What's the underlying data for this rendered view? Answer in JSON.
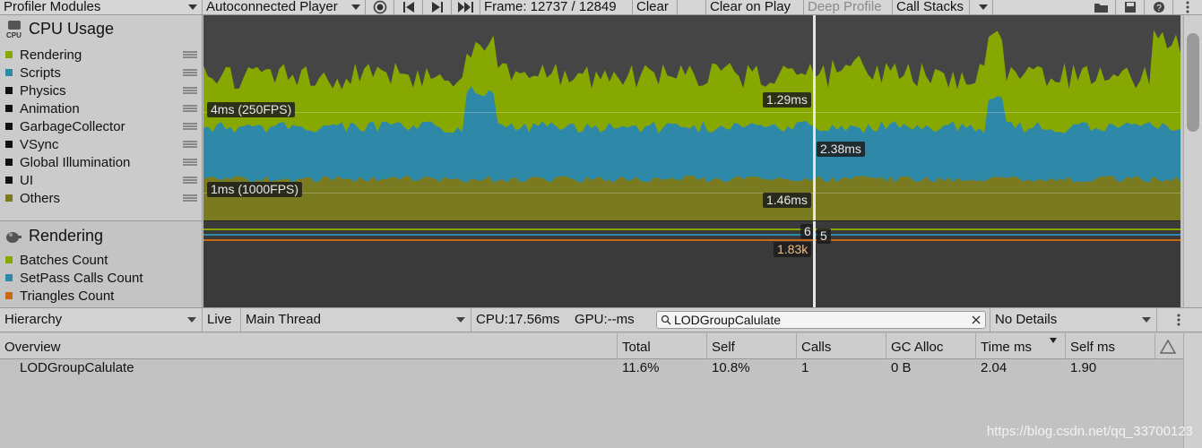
{
  "toolbar": {
    "modules_label": "Profiler Modules",
    "player_label": "Autoconnected Player",
    "frame_label": "Frame: 12737 / 12849",
    "clear_label": "Clear",
    "clear_on_play_label": "Clear on Play",
    "deep_profile_label": "Deep Profile",
    "call_stacks_label": "Call Stacks"
  },
  "cpu_module": {
    "title": "CPU Usage",
    "icon_text": "CPU",
    "legend": [
      {
        "label": "Rendering",
        "color": "#86a800"
      },
      {
        "label": "Scripts",
        "color": "#2e88a8"
      },
      {
        "label": "Physics",
        "color": "#111111"
      },
      {
        "label": "Animation",
        "color": "#111111"
      },
      {
        "label": "GarbageCollector",
        "color": "#111111"
      },
      {
        "label": "VSync",
        "color": "#111111"
      },
      {
        "label": "Global Illumination",
        "color": "#111111"
      },
      {
        "label": "UI",
        "color": "#111111"
      },
      {
        "label": "Others",
        "color": "#7a7a20"
      }
    ],
    "chart": {
      "line_4ms": "4ms (250FPS)",
      "line_1ms": "1ms (1000FPS)",
      "val_rendering": "1.29ms",
      "val_scripts": "2.38ms",
      "val_others": "1.46ms"
    }
  },
  "rendering_module": {
    "title": "Rendering",
    "legend": [
      {
        "label": "Batches Count",
        "color": "#86a800"
      },
      {
        "label": "SetPass Calls Count",
        "color": "#2e88a8"
      },
      {
        "label": "Triangles Count",
        "color": "#c86a14"
      }
    ],
    "chart": {
      "val_batches": "6",
      "val_setpass": "5",
      "val_triangles": "1.83k"
    }
  },
  "hierarchy_bar": {
    "view_label": "Hierarchy",
    "live_label": "Live",
    "thread_label": "Main Thread",
    "cpu_label": "CPU:17.56ms",
    "gpu_label": "GPU:--ms",
    "search_value": "LODGroupCalulate",
    "details_label": "No Details"
  },
  "table": {
    "columns": [
      "Overview",
      "Total",
      "Self",
      "Calls",
      "GC Alloc",
      "Time ms",
      "Self ms"
    ],
    "rows": [
      {
        "name": "LODGroupCalulate",
        "total": "11.6%",
        "self": "10.8%",
        "calls": "1",
        "gc": "0 B",
        "time": "2.04",
        "self_ms": "1.90"
      }
    ]
  },
  "colors": {
    "rendering": "#86a800",
    "scripts": "#2e88a8",
    "others": "#7a7a20",
    "triangles": "#c86a14",
    "chart_bg": "#454545"
  },
  "watermark": "https://blog.csdn.net/qq_33700123"
}
